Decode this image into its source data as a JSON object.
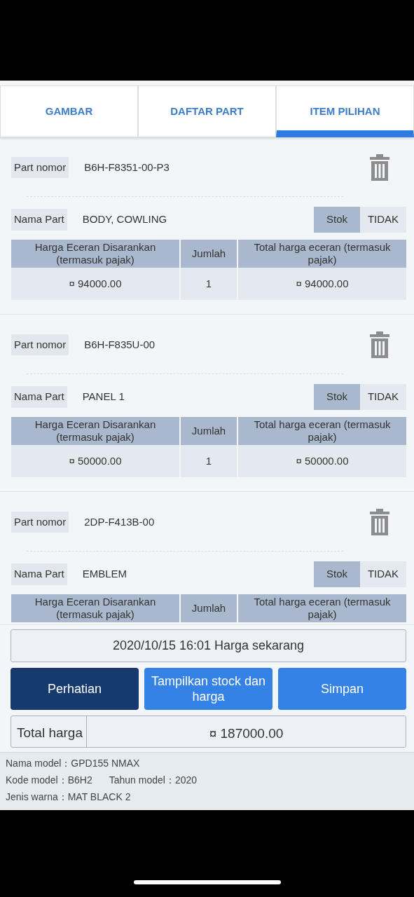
{
  "tabs": [
    {
      "label": "GAMBAR",
      "selected": false
    },
    {
      "label": "DAFTAR PART",
      "selected": false
    },
    {
      "label": "ITEM PILIHAN",
      "selected": true
    }
  ],
  "items": [
    {
      "part_number_label": "Part nomor",
      "part_number": "B6H-F8351-00-P3",
      "part_name_label": "Nama Part",
      "part_name": "BODY, COWLING",
      "stock_options": [
        {
          "label": "Stok",
          "selected": true
        },
        {
          "label": "TIDAK",
          "selected": false
        }
      ],
      "columns": [
        "Harga Eceran Disarankan (termasuk pajak)",
        "Jumlah",
        "Total harga eceran (termasuk pajak)"
      ],
      "row": [
        "¤ 94000.00",
        "1",
        "¤ 94000.00"
      ]
    },
    {
      "part_number_label": "Part nomor",
      "part_number": "B6H-F835U-00",
      "part_name_label": "Nama Part",
      "part_name": "PANEL 1",
      "stock_options": [
        {
          "label": "Stok",
          "selected": true
        },
        {
          "label": "TIDAK",
          "selected": false
        }
      ],
      "columns": [
        "Harga Eceran Disarankan (termasuk pajak)",
        "Jumlah",
        "Total harga eceran (termasuk pajak)"
      ],
      "row": [
        "¤ 50000.00",
        "1",
        "¤ 50000.00"
      ]
    },
    {
      "part_number_label": "Part nomor",
      "part_number": "2DP-F413B-00",
      "part_name_label": "Nama Part",
      "part_name": "EMBLEM",
      "stock_options": [
        {
          "label": "Stok",
          "selected": true
        },
        {
          "label": "TIDAK",
          "selected": false
        }
      ],
      "columns": [
        "Harga Eceran Disarankan (termasuk pajak)",
        "Jumlah",
        "Total harga eceran (termasuk pajak)"
      ]
    }
  ],
  "price_date_button": "2020/10/15 16:01 Harga sekarang",
  "buttons": [
    {
      "label": "Perhatian",
      "kind": "dark"
    },
    {
      "label": "Tampilkan stock dan harga",
      "kind": "primary"
    },
    {
      "label": "Simpan",
      "kind": "primary"
    }
  ],
  "total": {
    "label": "Total harga",
    "value": "¤ 187000.00"
  },
  "model_info": [
    [
      {
        "label": "Nama model：",
        "value": "GPD155 NMAX"
      }
    ],
    [
      {
        "label": "Kode model：",
        "value": "B6H2"
      },
      {
        "label": "Tahun model：",
        "value": "2020"
      }
    ],
    [
      {
        "label": "Jenis warna：",
        "value": "MAT BLACK 2"
      }
    ]
  ]
}
